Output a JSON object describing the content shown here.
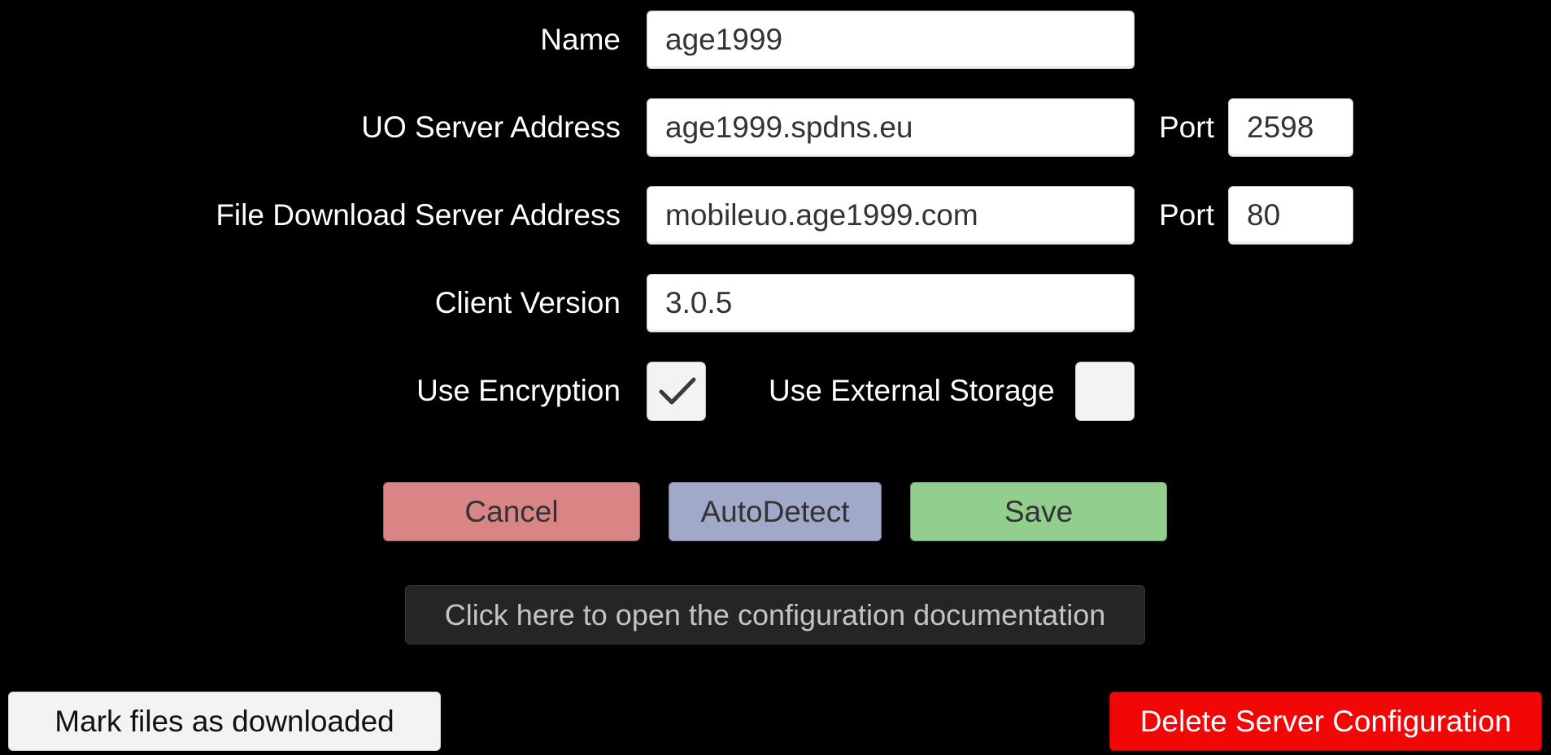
{
  "form": {
    "name": {
      "label": "Name",
      "value": "age1999"
    },
    "uo_server": {
      "label": "UO Server Address",
      "value": "age1999.spdns.eu",
      "port_label": "Port",
      "port_value": "2598"
    },
    "file_server": {
      "label": "File Download Server Address",
      "value": "mobileuo.age1999.com",
      "port_label": "Port",
      "port_value": "80"
    },
    "client_version": {
      "label": "Client Version",
      "value": "3.0.5"
    },
    "use_encryption": {
      "label": "Use Encryption",
      "checked": true
    },
    "use_external_storage": {
      "label": "Use External Storage",
      "checked": false
    }
  },
  "actions": {
    "cancel_label": "Cancel",
    "autodetect_label": "AutoDetect",
    "save_label": "Save",
    "docs_label": "Click here to open the configuration documentation",
    "mark_label": "Mark files as downloaded",
    "delete_label": "Delete Server Configuration"
  },
  "colors": {
    "background": "#000000",
    "cancel": "#d98585",
    "autodetect": "#a1a9c9",
    "save": "#92cf8f",
    "docs": "#252525",
    "delete": "#f20606"
  },
  "icons": {
    "checkmark": "checkmark-icon"
  }
}
